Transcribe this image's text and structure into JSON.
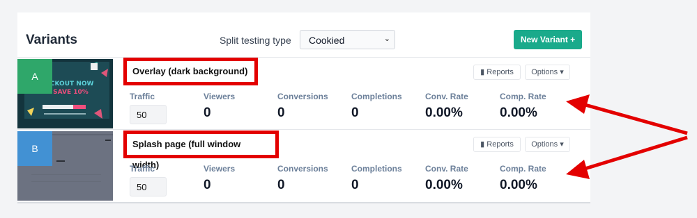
{
  "header": {
    "title": "Variants",
    "split_label": "Split testing type",
    "split_value": "Cookied",
    "new_variant_label": "New Variant +"
  },
  "variants": [
    {
      "letter": "A",
      "name": "Overlay (dark background)",
      "thumb_text_1": "CHECKOUT NOW",
      "thumb_text_2": "TO SAVE 10%",
      "reports": "Reports",
      "options": "Options",
      "traffic": "50",
      "viewers": "0",
      "conversions": "0",
      "completions": "0",
      "conv_rate": "0.00%",
      "comp_rate": "0.00%"
    },
    {
      "letter": "B",
      "name": "Splash page (full window width)",
      "reports": "Reports",
      "options": "Options",
      "traffic": "50",
      "viewers": "0",
      "conversions": "0",
      "completions": "0",
      "conv_rate": "0.00%",
      "comp_rate": "0.00%"
    }
  ],
  "labels": {
    "traffic": "Traffic",
    "viewers": "Viewers",
    "conversions": "Conversions",
    "completions": "Completions",
    "conv_rate": "Conv. Rate",
    "comp_rate": "Comp. Rate"
  },
  "colors": {
    "accent": "#1aaa8b",
    "annotation": "#e30000",
    "variant_a": "#2fa76a",
    "variant_b": "#4291d3"
  }
}
